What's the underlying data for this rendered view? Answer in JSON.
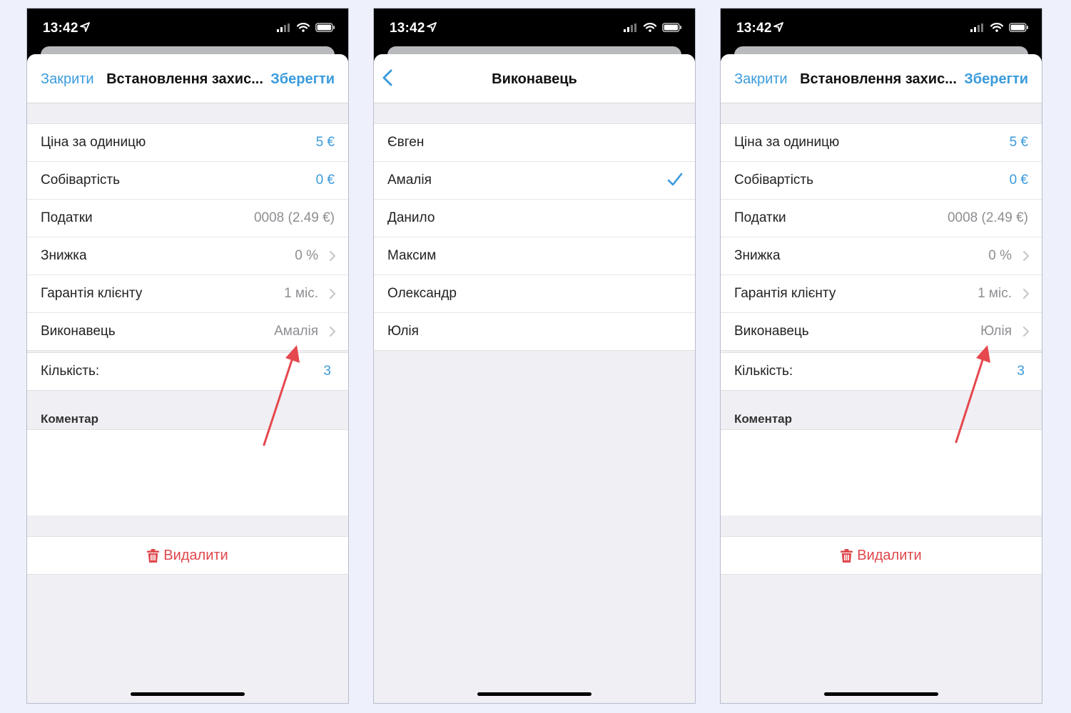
{
  "status": {
    "time": "13:42"
  },
  "screens": [
    {
      "nav": {
        "close": "Закрити",
        "title": "Встановлення захис...",
        "save": "Зберегти"
      },
      "rows": [
        {
          "label": "Ціна за одиницю",
          "value": "5 €"
        },
        {
          "label": "Собівартість",
          "value": "0 €"
        },
        {
          "label": "Податки",
          "value": "0008 (2.49 €)"
        },
        {
          "label": "Знижка",
          "value": "0 %"
        },
        {
          "label": "Гарантія клієнту",
          "value": "1 міс."
        },
        {
          "label": "Виконавець",
          "value": "Амалія"
        }
      ],
      "quantity": {
        "label": "Кількість:",
        "value": "3"
      },
      "comment_header": "Коментар",
      "delete": "Видалити"
    },
    {
      "nav": {
        "title": "Виконавець"
      },
      "options": [
        "Євген",
        "Амалія",
        "Данило",
        "Максим",
        "Олександр",
        "Юлія"
      ],
      "selected": "Амалія"
    },
    {
      "nav": {
        "close": "Закрити",
        "title": "Встановлення захис...",
        "save": "Зберегти"
      },
      "rows": [
        {
          "label": "Ціна за одиницю",
          "value": "5 €"
        },
        {
          "label": "Собівартість",
          "value": "0 €"
        },
        {
          "label": "Податки",
          "value": "0008 (2.49 €)"
        },
        {
          "label": "Знижка",
          "value": "0 %"
        },
        {
          "label": "Гарантія клієнту",
          "value": "1 міс."
        },
        {
          "label": "Виконавець",
          "value": "Юлія"
        }
      ],
      "quantity": {
        "label": "Кількість:",
        "value": "3"
      },
      "comment_header": "Коментар",
      "delete": "Видалити"
    }
  ],
  "colors": {
    "accent": "#3a9bdc",
    "destructive": "#e0474c",
    "annotation_arrow": "#e5484d"
  }
}
